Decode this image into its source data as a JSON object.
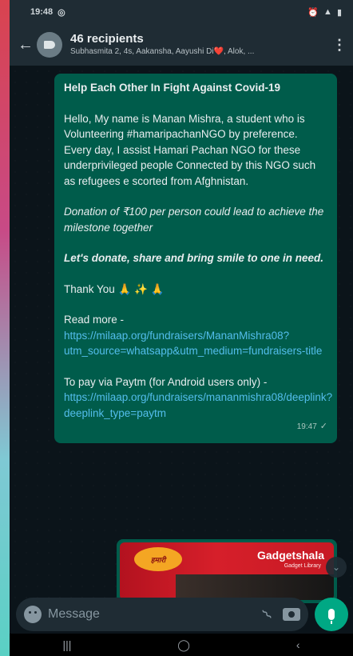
{
  "status_bar": {
    "time": "19:48",
    "left_icons": [
      "whatsapp-icon"
    ],
    "right_icons": [
      "alarm-icon",
      "signal-icon",
      "battery-icon"
    ]
  },
  "header": {
    "back_icon": "arrow-left-icon",
    "avatar_icon": "broadcast-megaphone-icon",
    "title": "46 recipients",
    "subtitle": "Subhasmita 2, 4s, Aakansha, Aayushi Di❤️, Alok, ...",
    "menu_icon": "more-vert-icon"
  },
  "message": {
    "heading": "Help Each Other In Fight Against Covid-19",
    "intro": "Hello, My name is Manan Mishra, a student who is Volunteering #hamaripachanNGO by preference. Every day, I assist Hamari Pachan NGO for these underprivileged people Connected by this NGO such as refugees e scorted from Afghnistan.",
    "donation": "Donation of ₹100 per person could lead to achieve the milestone together",
    "call_to_action": "Let's donate, share and bring smile to one in need.",
    "thanks": "Thank You 🙏 ✨ 🙏",
    "read_more_label": "Read more - ",
    "read_more_link": "https://milaap.org/fundraisers/MananMishra08?utm_source=whatsapp&utm_medium=fundraisers-title",
    "paytm_label": "To pay via Paytm (for Android users only) - ",
    "paytm_link": "https://milaap.org/fundraisers/mananmishra08/deeplink?deeplink_type=paytm",
    "time": "19:47"
  },
  "image_message": {
    "badge_text": "हमारी",
    "brand": "Gadgetshala",
    "brand_sub": "Gadget Library"
  },
  "composer": {
    "placeholder": "Message",
    "emoji_icon": "emoji-icon",
    "attach_icon": "paperclip-icon",
    "camera_icon": "camera-icon",
    "mic_icon": "mic-icon"
  },
  "navigation": {
    "recents": "|||",
    "home": "◯",
    "back": "‹"
  },
  "colors": {
    "header_bg": "#1f2c34",
    "chat_bg": "#0b141a",
    "outgoing_bubble": "#005c4b",
    "link": "#53bdeb",
    "accent": "#00a884"
  }
}
